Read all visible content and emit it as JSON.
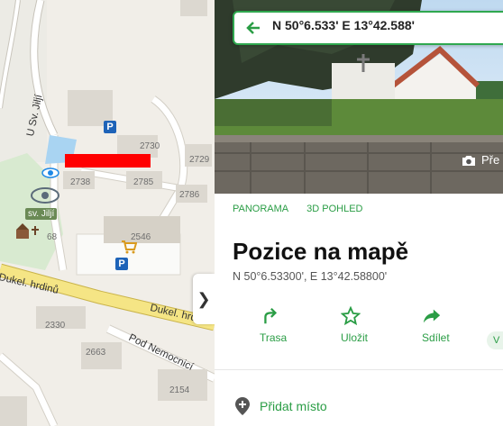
{
  "map": {
    "street_sv_jilji": "U Sv. Jiljí",
    "street_dukel_1": "Dukel. hrdinů",
    "street_dukel_2": "Dukel. hrdinů",
    "street_nemocnici": "Pod Nemocnicí",
    "poi_sv_jilji": "sv. Jiljí",
    "house_numbers": [
      "2730",
      "2729",
      "2738",
      "2785",
      "2786",
      "2546",
      "68",
      "2330",
      "2663",
      "2154"
    ],
    "parking_label": "P",
    "collapse_icon": "chevron-right-icon"
  },
  "search": {
    "value": "N 50°6.533' E 13°42.588'",
    "back_icon": "arrow-left-icon"
  },
  "photo": {
    "button_label": "Pře",
    "button_icon": "camera-icon"
  },
  "tabs": [
    "PANORAMA",
    "3D POHLED"
  ],
  "place": {
    "title": "Pozice na mapě",
    "coords": "N 50°6.53300', E 13°42.58800'"
  },
  "actions": [
    {
      "label": "Trasa",
      "icon": "route-icon"
    },
    {
      "label": "Uložit",
      "icon": "star-icon"
    },
    {
      "label": "Sdílet",
      "icon": "share-icon"
    }
  ],
  "more_pill": "V",
  "add_place": {
    "label": "Přidat místo",
    "icon": "add-location-icon"
  },
  "colors": {
    "accent_green": "#2a9d45",
    "parking_blue": "#1e63b8",
    "marker_red": "#ff0000"
  }
}
